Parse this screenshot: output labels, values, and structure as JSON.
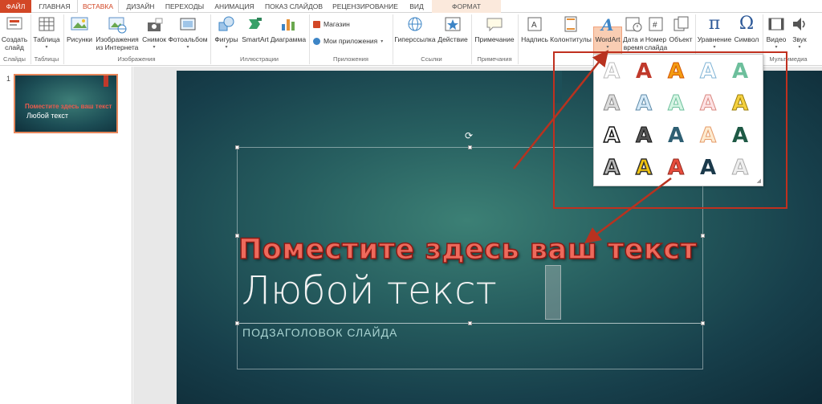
{
  "tabs": {
    "file": "ФАЙЛ",
    "home": "ГЛАВНАЯ",
    "insert": "ВСТАВКА",
    "design": "ДИЗАЙН",
    "transitions": "ПЕРЕХОДЫ",
    "animations": "АНИМАЦИЯ",
    "slideshow": "ПОКАЗ СЛАЙДОВ",
    "review": "РЕЦЕНЗИРОВАНИЕ",
    "view": "ВИД",
    "format": "ФОРМАТ"
  },
  "ribbon": {
    "new_slide_1": "Создать",
    "new_slide_2": "слайд",
    "table": "Таблица",
    "pictures": "Рисунки",
    "online_pictures_1": "Изображения",
    "online_pictures_2": "из Интернета",
    "screenshot": "Снимок",
    "photo_album": "Фотоальбом",
    "shapes": "Фигуры",
    "smartart": "SmartArt",
    "chart": "Диаграмма",
    "store": "Магазин",
    "my_apps": "Мои приложения",
    "hyperlink": "Гиперссылка",
    "action": "Действие",
    "comment": "Примечание",
    "textbox": "Надпись",
    "header_footer": "Колонтитулы",
    "wordart": "WordArt",
    "datetime_1": "Дата и",
    "datetime_2": "время",
    "slide_number_1": "Номер",
    "slide_number_2": "слайда",
    "object": "Объект",
    "equation": "Уравнение",
    "symbol": "Символ",
    "video": "Видео",
    "audio": "Звук",
    "groups": {
      "slides": "Слайды",
      "tables": "Таблицы",
      "images": "Изображения",
      "illustrations": "Иллюстрации",
      "apps": "Приложения",
      "links": "Ссылки",
      "comments": "Примечания",
      "multimedia": "Мультимедиа"
    }
  },
  "thumbnail": {
    "number": "1",
    "title": "Поместите здесь ваш текст",
    "subtitle": "Любой текст"
  },
  "slide": {
    "wordart_text": "Поместите здесь ваш текст",
    "title_text": "Любой текст",
    "subtitle_text": "ПОДЗАГОЛОВОК СЛАЙДА"
  },
  "gallery": {
    "glyph": "A",
    "resize_glyph": "◢"
  },
  "colors": {
    "accent": "#d24726",
    "annotation": "#c0301f",
    "slide_bg": "#275f60",
    "wordart_fill": "#ee6a5c"
  }
}
